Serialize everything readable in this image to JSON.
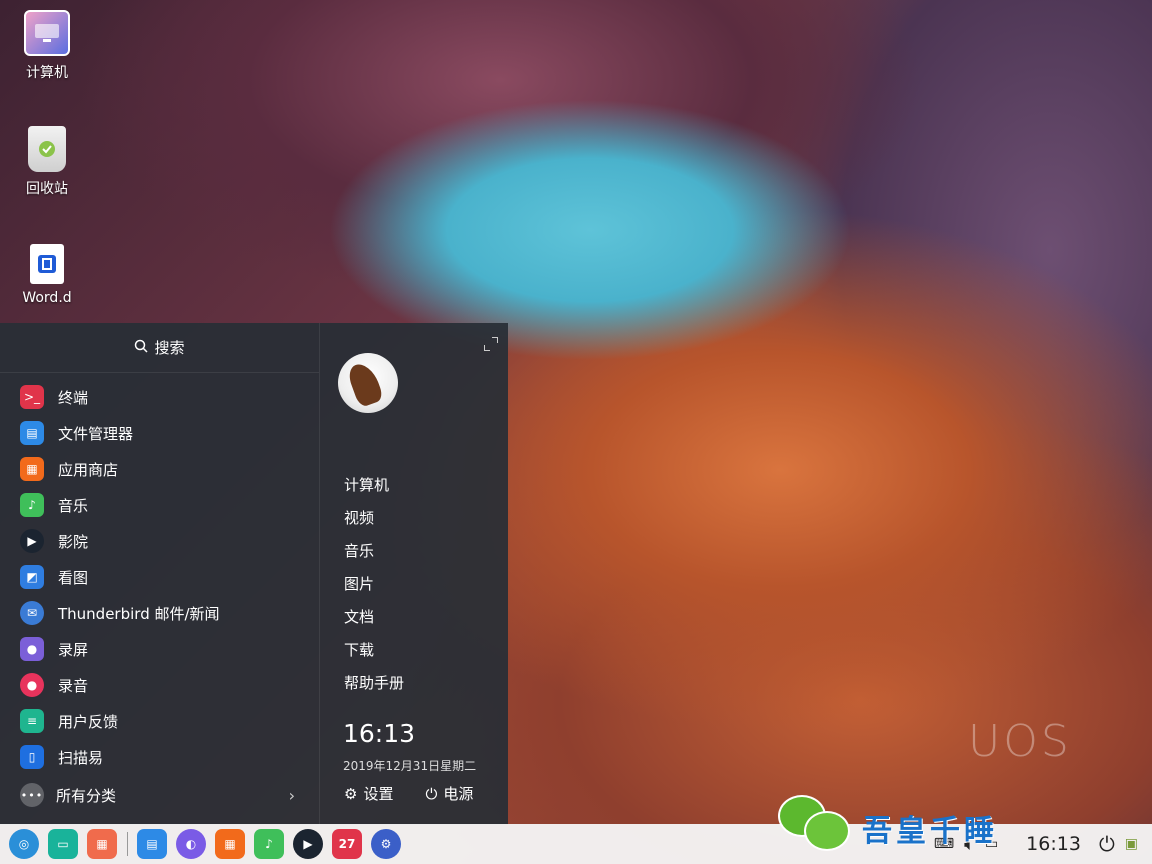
{
  "desktop": {
    "icons": [
      {
        "label": "计算机",
        "icon": "computer-icon"
      },
      {
        "label": "回收站",
        "icon": "trash-icon"
      },
      {
        "label": "Word.d",
        "icon": "word-document-icon"
      }
    ],
    "wallpaper_watermark": "UOS"
  },
  "launcher": {
    "search_label": "搜索",
    "apps": [
      {
        "label": "终端",
        "icon": "terminal-icon",
        "color": "#e0344a"
      },
      {
        "label": "文件管理器",
        "icon": "file-manager-icon",
        "color": "#2d8ae6"
      },
      {
        "label": "应用商店",
        "icon": "app-store-icon",
        "color": "#f26a1b"
      },
      {
        "label": "音乐",
        "icon": "music-icon",
        "color": "#3fbf5a"
      },
      {
        "label": "影院",
        "icon": "movie-icon",
        "color": "#1b2430"
      },
      {
        "label": "看图",
        "icon": "image-viewer-icon",
        "color": "#2f7de0"
      },
      {
        "label": "Thunderbird 邮件/新闻",
        "icon": "thunderbird-icon",
        "color": "#3a7bd5"
      },
      {
        "label": "录屏",
        "icon": "screen-recorder-icon",
        "color": "#7b5fd8"
      },
      {
        "label": "录音",
        "icon": "voice-recorder-icon",
        "color": "#e8335c"
      },
      {
        "label": "用户反馈",
        "icon": "feedback-icon",
        "color": "#1fb58f"
      },
      {
        "label": "扫描易",
        "icon": "scanner-icon",
        "color": "#1e6fe0"
      }
    ],
    "all_categories_label": "所有分类",
    "places": [
      "计算机",
      "视频",
      "音乐",
      "图片",
      "文档",
      "下载",
      "帮助手册"
    ],
    "time": "16:13",
    "date": "2019年12月31日星期二",
    "settings_label": "设置",
    "power_label": "电源"
  },
  "taskbar": {
    "dock_apps": [
      {
        "icon": "launcher-icon",
        "color": "#2a8fd8"
      },
      {
        "icon": "multitask-view-icon",
        "color": "#19b39a"
      },
      {
        "icon": "control-center-icon",
        "color": "#f06b4c"
      },
      {
        "icon": "file-manager-icon",
        "color": "#2d8ae6"
      },
      {
        "icon": "browser-icon",
        "color": "#7a5be6"
      },
      {
        "icon": "app-store-icon",
        "color": "#f26a1b"
      },
      {
        "icon": "music-icon",
        "color": "#3fbf5a"
      },
      {
        "icon": "movie-icon",
        "color": "#1b2430"
      },
      {
        "icon": "calendar-icon",
        "color": "#e0344a",
        "text": "27"
      },
      {
        "icon": "settings-icon",
        "color": "#3b5fc8"
      }
    ],
    "clock": "16:13",
    "overlay_text": "吾皇千睡"
  }
}
